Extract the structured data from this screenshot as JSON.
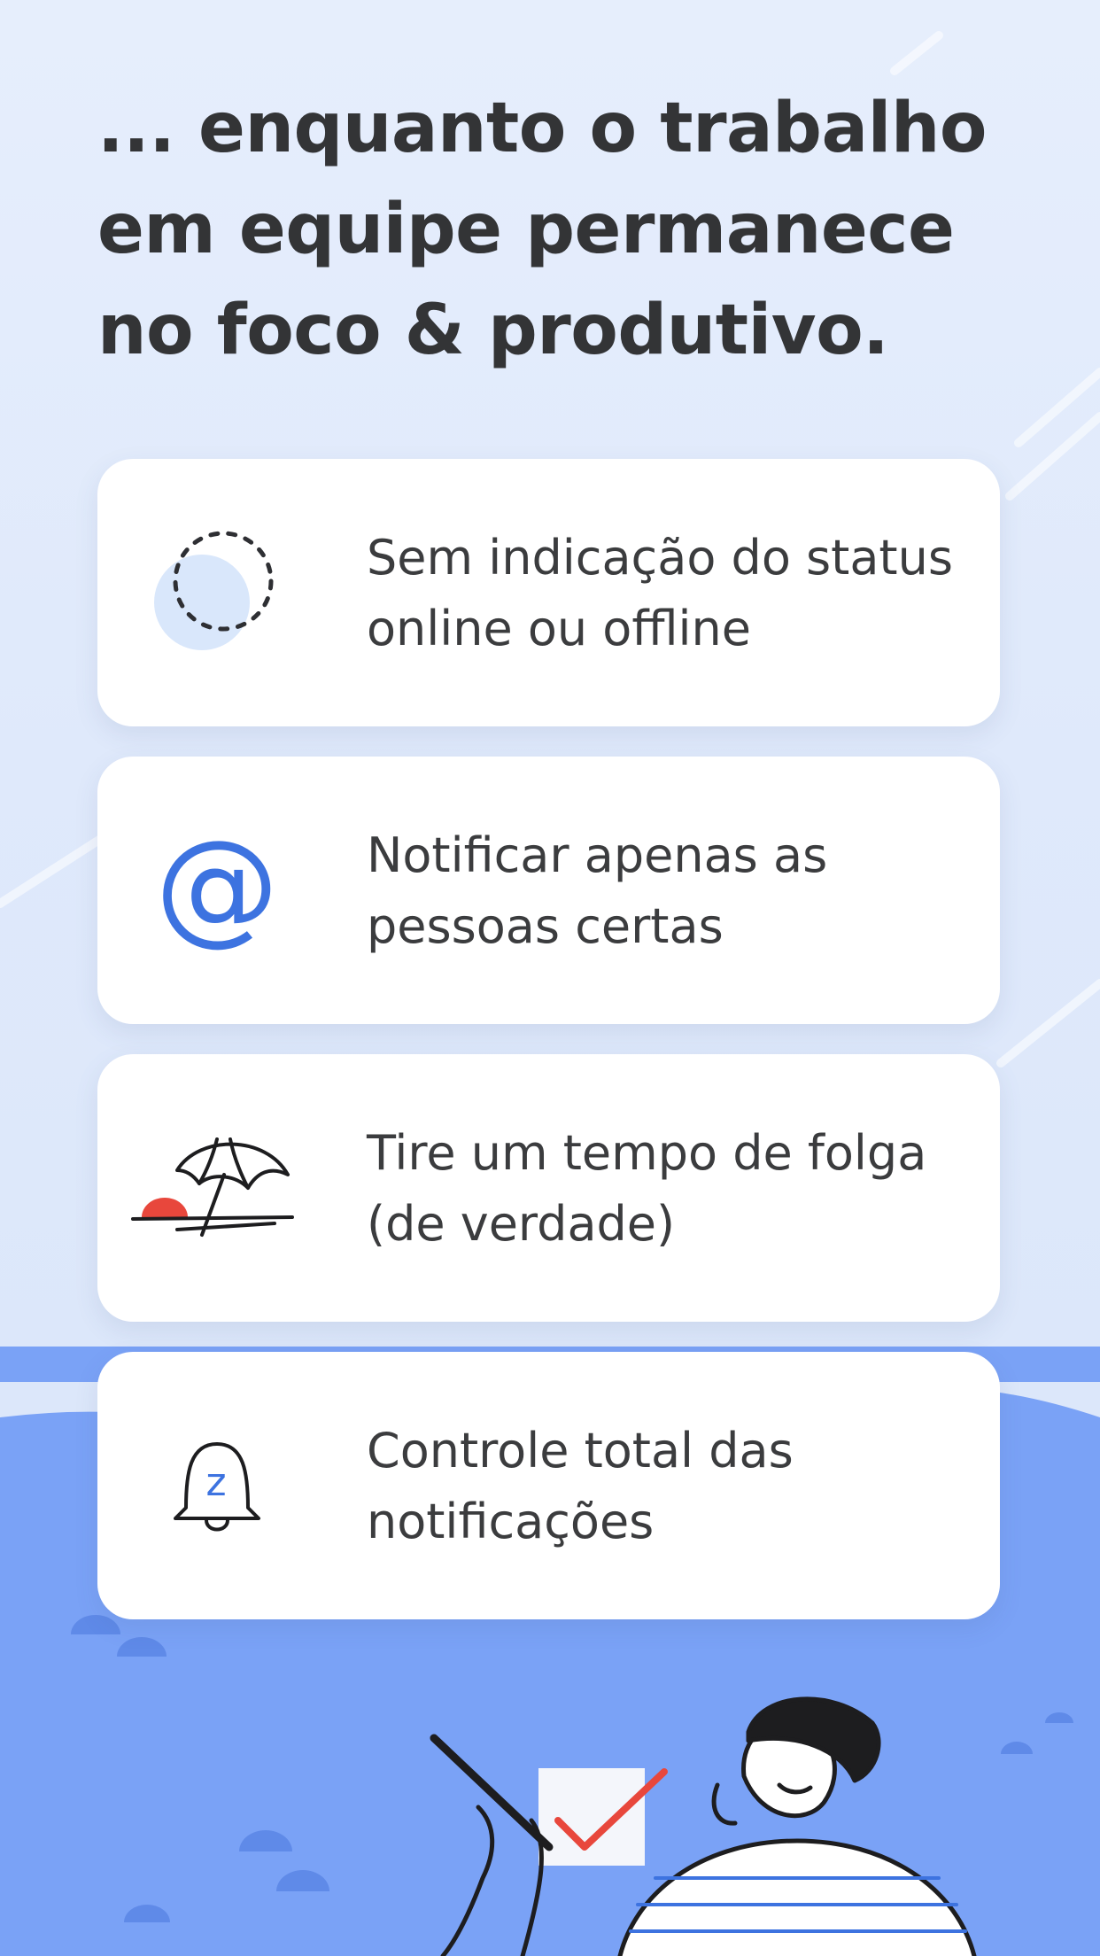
{
  "headline": "... enquanto o trabalho em equipe permanece no foco & produtivo.",
  "features": [
    {
      "icon": "status-circle-icon",
      "text": "Sem indicação do status online ou offline"
    },
    {
      "icon": "at-mention-icon",
      "glyph": "@",
      "text": "Notificar apenas as pessoas certas"
    },
    {
      "icon": "beach-umbrella-icon",
      "text": "Tire um tempo de folga (de verdade)"
    },
    {
      "icon": "snooze-bell-icon",
      "glyph": "z",
      "text": "Controle total das notificações"
    }
  ],
  "colors": {
    "background_light": "#e3ecfb",
    "background_blue": "#7aa2f6",
    "accent_blue": "#3d73e0",
    "accent_red": "#e8473c",
    "text_dark": "#333436"
  }
}
